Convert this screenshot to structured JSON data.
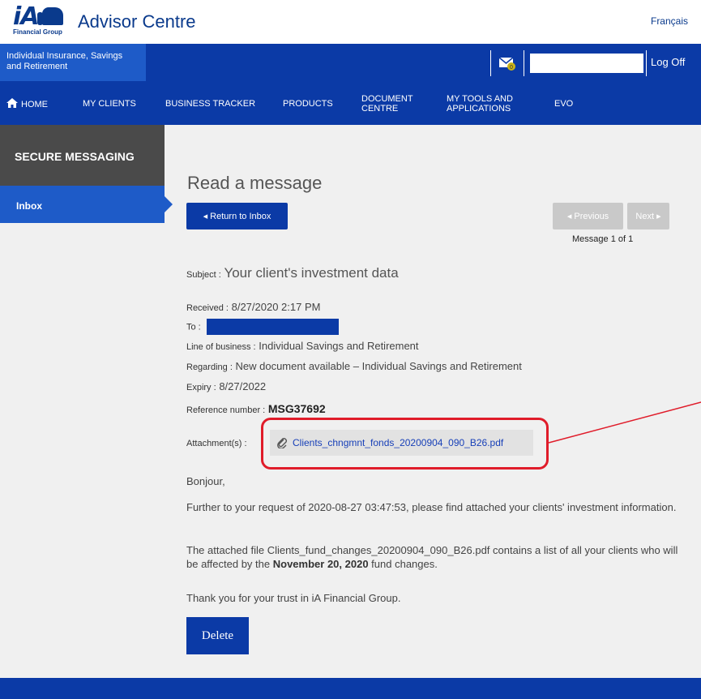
{
  "header": {
    "logo_text": "iA",
    "logo_subtitle": "Financial Group",
    "app_title": "Advisor Centre",
    "language_link": "Français"
  },
  "topbar": {
    "line_of_business": "Individual Insurance, Savings and Retirement",
    "search_value": "",
    "logoff_label": "Log Off"
  },
  "nav": {
    "items": [
      {
        "label": "HOME"
      },
      {
        "label": "MY CLIENTS"
      },
      {
        "label": "BUSINESS TRACKER"
      },
      {
        "label": "PRODUCTS"
      },
      {
        "label": "DOCUMENT CENTRE"
      },
      {
        "label": "MY TOOLS AND APPLICATIONS"
      },
      {
        "label": "EVO"
      }
    ]
  },
  "sidebar": {
    "title": "SECURE MESSAGING",
    "items": [
      {
        "label": "Inbox"
      }
    ]
  },
  "message": {
    "page_title": "Read a message",
    "return_label": "◂ Return to Inbox",
    "previous_label": "◂ Previous",
    "next_label": "Next ▸",
    "pager_text": "Message 1 of 1",
    "subject_label": "Subject :",
    "subject_value": "Your client's investment data",
    "received_label": "Received :",
    "received_value": "8/27/2020 2:17 PM",
    "to_label": "To :",
    "lob_label": "Line of business :",
    "lob_value": "Individual Savings and Retirement",
    "regarding_label": "Regarding :",
    "regarding_value": "New document available – Individual Savings and Retirement",
    "expiry_label": "Expiry :",
    "expiry_value": "8/27/2022",
    "ref_label": "Reference number :",
    "ref_value": "MSG37692",
    "attach_label": "Attachment(s) :",
    "attach_file": "Clients_chngmnt_fonds_20200904_090_B26.pdf",
    "greeting": "Bonjour,",
    "para1": "Further to your request of 2020-08-27 03:47:53, please find attached your clients' investment information.",
    "para2_before": "The attached file Clients_fund_changes_20200904_090_B26.pdf contains a list of all your clients who will be affected by the",
    "para2_bold": "November 20, 2020",
    "para2_after": "fund changes.",
    "para3": "Thank you for your trust in iA Financial Group.",
    "delete_label": "Delete"
  },
  "colors": {
    "primary_blue": "#0b3aa6",
    "light_blue": "#1e5bc8",
    "sidebar_dark": "#4a4a4a",
    "callout_red": "#e01c2a"
  },
  "icons": [
    "home-icon",
    "mail-notification-icon",
    "paperclip-icon",
    "triangle-left-icon",
    "triangle-right-icon"
  ]
}
